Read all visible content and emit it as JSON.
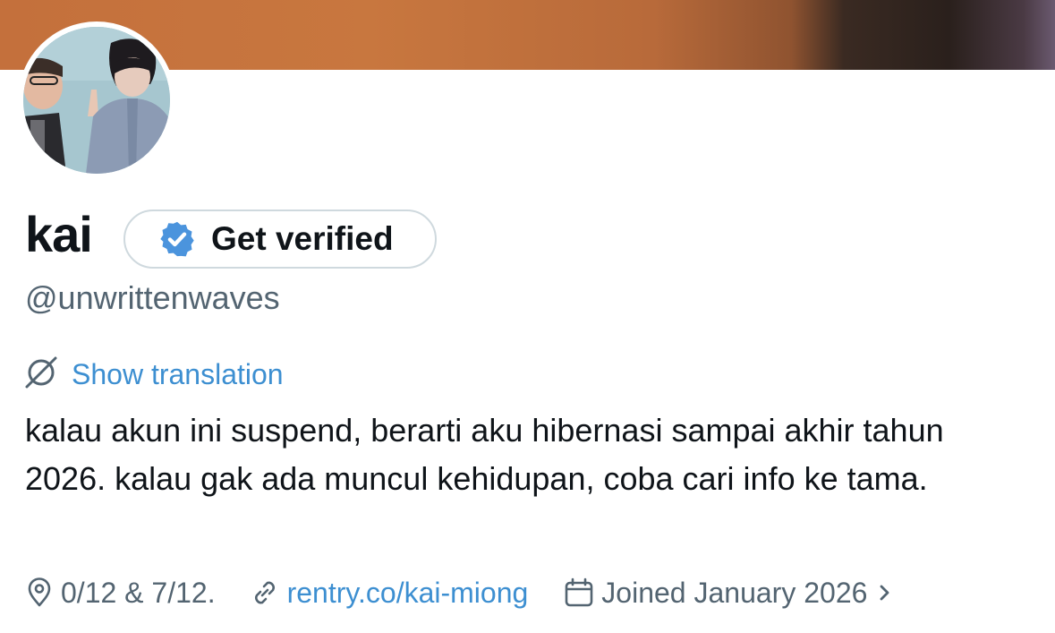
{
  "profile": {
    "name": "kai",
    "handle": "@unwrittenwaves",
    "verify_label": "Get verified",
    "translate_label": "Show translation",
    "bio": "kalau akun ini suspend, berarti aku hibernasi sampai akhir tahun 2026. kalau gak ada muncul kehidupan, coba cari info ke tama.",
    "location": "0/12 & 7/12.",
    "website": "rentry.co/kai-miong",
    "joined": "Joined January 2026"
  },
  "icons": {
    "badge": "verified-badge-icon",
    "translate": "translate-icon",
    "location": "location-pin-icon",
    "link": "link-icon",
    "calendar": "calendar-icon",
    "chevron": "chevron-right-icon"
  },
  "colors": {
    "accent": "#3d8fd1",
    "badge": "#4b94dd",
    "secondary_text": "#536471",
    "primary_text": "#0f1419",
    "border": "#cfd9de"
  }
}
